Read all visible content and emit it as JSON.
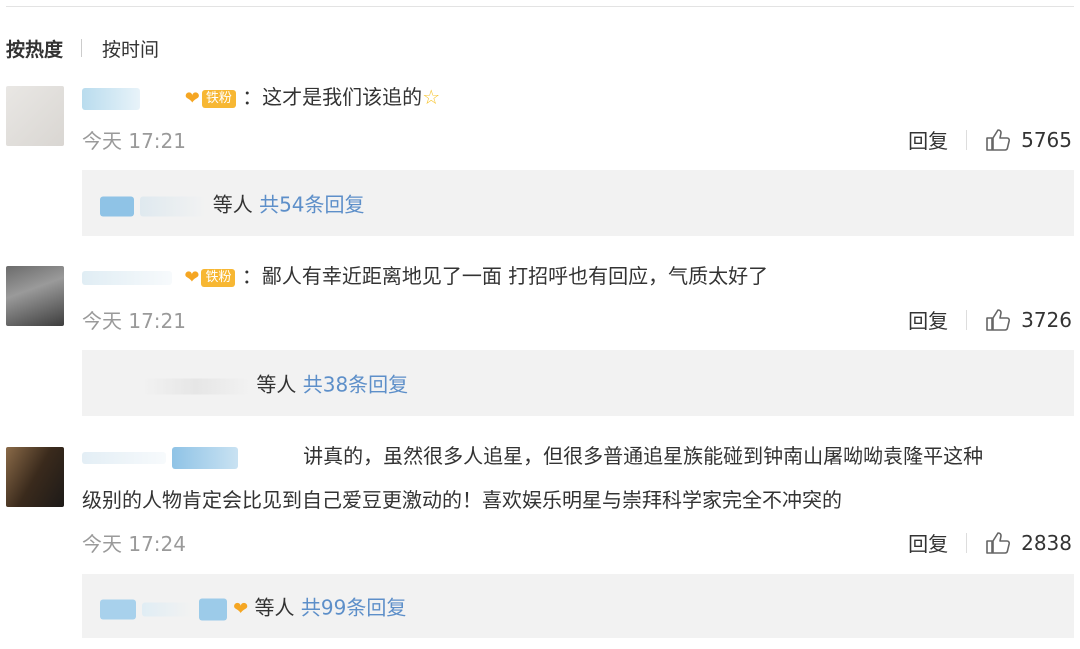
{
  "sort": {
    "hot": "按热度",
    "time": "按时间"
  },
  "comments": [
    {
      "badge": "铁粉",
      "text": "：这才是我们该追的",
      "time": "今天 17:21",
      "reply_label": "回复",
      "likes": "5765",
      "reply_summary": {
        "others": "等人",
        "count": "共54条回复"
      }
    },
    {
      "badge": "铁粉",
      "text": "：鄙人有幸近距离地见了一面 打招呼也有回应，气质太好了",
      "time": "今天 17:21",
      "reply_label": "回复",
      "likes": "3726",
      "reply_summary": {
        "others": "等人",
        "count": "共38条回复"
      }
    },
    {
      "text_line1": "讲真的，虽然很多人追星，但很多普通追星族能碰到钟南山屠呦呦袁隆平这种",
      "text_line2": "级别的人物肯定会比见到自己爱豆更激动的！喜欢娱乐明星与崇拜科学家完全不冲突的",
      "time": "今天 17:24",
      "reply_label": "回复",
      "likes": "2838",
      "reply_summary": {
        "others": "等人",
        "count": "共99条回复"
      }
    }
  ],
  "icons": {
    "like": "thumbs-up-icon",
    "badge": "fan-heart-icon",
    "star": "star-emoji-icon"
  }
}
